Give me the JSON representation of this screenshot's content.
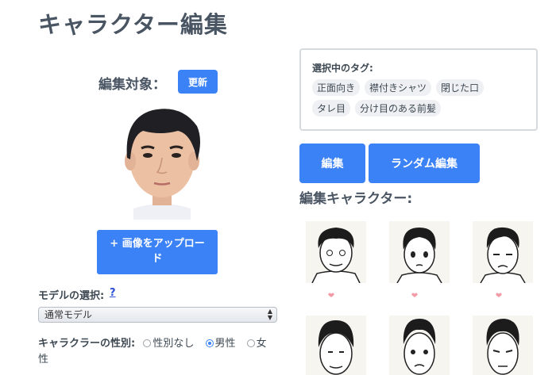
{
  "page": {
    "title": "キャラクター編集"
  },
  "target": {
    "label": "編集対象：",
    "refresh_label": "更新"
  },
  "upload": {
    "label": "+ 画像をアップロード"
  },
  "model": {
    "label": "モデルの選択:",
    "help": "?",
    "selected": "通常モデル"
  },
  "gender": {
    "label": "キャラクラーの性別:",
    "options": [
      {
        "label": "性別なし",
        "checked": false
      },
      {
        "label": "男性",
        "checked": true
      },
      {
        "label": "女性",
        "checked": false
      }
    ]
  },
  "tags": {
    "title": "選択中のタグ:",
    "items": [
      "正面向き",
      "襟付きシャツ",
      "閉じた口",
      "タレ目",
      "分け目のある前髪"
    ]
  },
  "actions": {
    "edit_label": "編集",
    "random_label": "ランダム編集"
  },
  "characters": {
    "title": "編集キャラクター:",
    "heart": "❤"
  },
  "colors": {
    "accent": "#3b82f6",
    "heart": "#f29aa6"
  }
}
